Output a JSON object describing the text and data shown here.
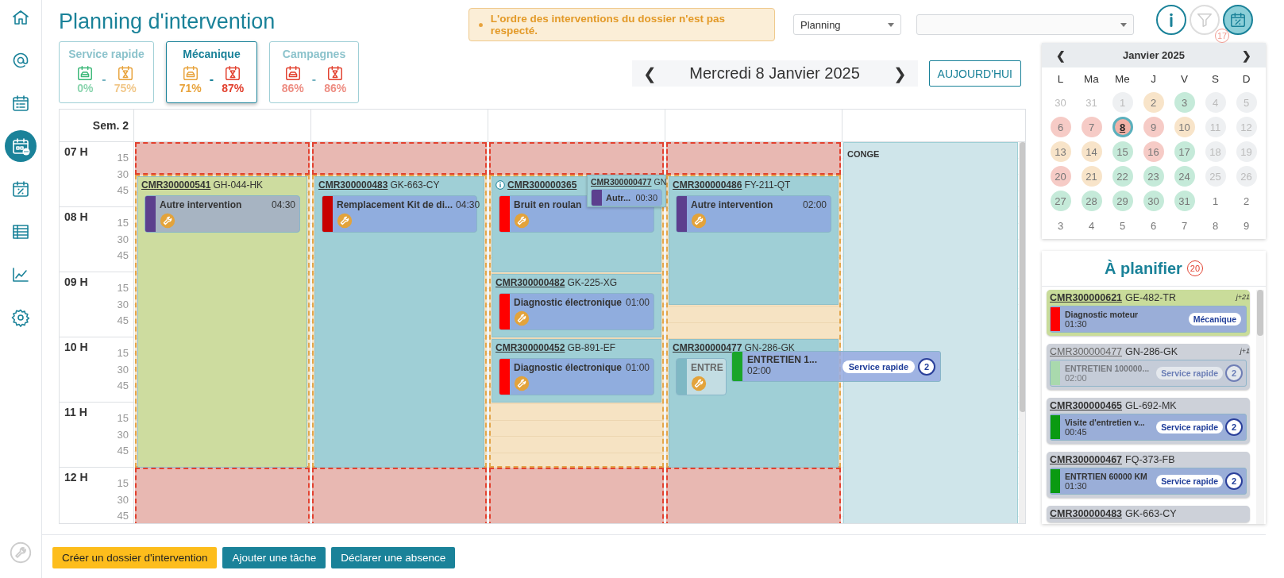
{
  "sidebar": {
    "items": [
      {
        "selected": false
      },
      {
        "selected": false
      },
      {
        "selected": false
      },
      {
        "selected": true
      },
      {
        "selected": false
      },
      {
        "selected": false
      },
      {
        "selected": false
      },
      {
        "selected": false
      }
    ]
  },
  "header": {
    "title": "Planning d'intervention"
  },
  "alert": {
    "messages": [
      "L'ordre des interventions du dossier n'est pas respecté."
    ]
  },
  "view_select": {
    "value": "Planning"
  },
  "toolbar": {
    "filter_count": "17",
    "filter_disabled": true,
    "planning_selected": true
  },
  "counters": [
    {
      "label": "Service rapide",
      "selected": false,
      "separator": "-",
      "stats": [
        {
          "value": "0%",
          "color": "#3cb878"
        },
        {
          "value": "75%",
          "color": "#e8a33c"
        }
      ]
    },
    {
      "label": "Mécanique",
      "selected": true,
      "separator": "-",
      "stats": [
        {
          "value": "71%",
          "color": "#e8a33c"
        },
        {
          "value": "87%",
          "color": "#e2412f"
        }
      ]
    },
    {
      "label": "Campagnes",
      "selected": false,
      "separator": "-",
      "stats": [
        {
          "value": "86%",
          "color": "#e2412f"
        },
        {
          "value": "86%",
          "color": "#e2412f"
        }
      ]
    }
  ],
  "date_nav": {
    "prev": "❮",
    "date": "Mercredi 8 Janvier 2025",
    "next": "❯",
    "today": "AUJOURD'HUI"
  },
  "planning": {
    "week": "Sem. 2",
    "hours": [
      {
        "label": "07 H",
        "quarters": [
          "15",
          "30",
          "45"
        ]
      },
      {
        "label": "08 H",
        "quarters": [
          "15",
          "30",
          "45"
        ]
      },
      {
        "label": "09 H",
        "quarters": [
          "15",
          "30",
          "45"
        ]
      },
      {
        "label": "10 H",
        "quarters": [
          "15",
          "30",
          "45"
        ]
      },
      {
        "label": "11 H",
        "quarters": [
          "15",
          "30",
          "45"
        ]
      },
      {
        "label": "12 H",
        "quarters": [
          "15",
          "30",
          "45"
        ]
      }
    ],
    "resources": [
      {
        "blocks": [
          {
            "kind": "closed"
          },
          {
            "kind": "open"
          },
          {
            "kind": "closed"
          },
          {
            "kind": "dossier",
            "color": "#cddc9f",
            "info": false,
            "id": "CMR300000541",
            "plate": "GH-044-HK",
            "tasks": [
              {
                "name": "Autre intervention",
                "duration": "04:30",
                "color": "#5c3f8e",
                "ghost": false
              }
            ]
          }
        ]
      },
      {
        "blocks": [
          {
            "kind": "closed"
          },
          {
            "kind": "open"
          },
          {
            "kind": "closed"
          },
          {
            "kind": "dossier",
            "color": "#9fcfd6",
            "info": false,
            "id": "CMR300000483",
            "plate": "GK-663-CY",
            "tasks": [
              {
                "name": "Remplacement Kit de di...",
                "duration": "04:30",
                "color": "#c80000",
                "ghost": false
              }
            ]
          }
        ]
      },
      {
        "blocks": [
          {
            "kind": "closed"
          },
          {
            "kind": "open"
          },
          {
            "kind": "closed"
          },
          {
            "kind": "dossier",
            "color": "#9fcfd6",
            "info": true,
            "id": "CMR300000365",
            "tasks": [
              {
                "name": "Bruit en roulan",
                "color": "#ff0000",
                "ghost": false
              }
            ]
          },
          {
            "kind": "overlay",
            "color": "#9fcfd6",
            "info": false,
            "id": "CMR300000477",
            "plate": "GN",
            "tasks": [
              {
                "name": "Autr...",
                "duration": "00:30",
                "color": "#5c3f8e",
                "ghost": false
              }
            ]
          },
          {
            "kind": "dossier",
            "color": "#9fcfd6",
            "info": false,
            "id": "CMR300000482",
            "plate": "GK-225-XG",
            "tasks": [
              {
                "name": "Diagnostic électronique",
                "duration": "01:00",
                "color": "#ff0000",
                "ghost": false
              }
            ]
          },
          {
            "kind": "dossier",
            "color": "#9fcfd6",
            "info": false,
            "id": "CMR300000452",
            "plate": "GB-891-EF",
            "tasks": [
              {
                "name": "Diagnostic électronique",
                "duration": "01:00",
                "color": "#ff0000",
                "ghost": false
              }
            ]
          }
        ]
      },
      {
        "blocks": [
          {
            "kind": "closed"
          },
          {
            "kind": "open"
          },
          {
            "kind": "closed"
          },
          {
            "kind": "dossier",
            "color": "#9fcfd6",
            "info": false,
            "id": "CMR300000486",
            "plate": "FY-211-QT",
            "tasks": [
              {
                "name": "Autre intervention",
                "duration": "02:00",
                "color": "#5c3f8e",
                "ghost": false
              }
            ]
          },
          {
            "kind": "dossier",
            "color": "#9fcfd6",
            "info": false,
            "id": "CMR300000477",
            "plate": "GN-286-GK",
            "tasks": [
              {
                "name": "ENTRE",
                "color": "#7fb8c4",
                "ghost": true
              }
            ]
          }
        ]
      },
      {
        "blocks": [
          {
            "kind": "absence",
            "label": "CONGE"
          }
        ]
      }
    ],
    "drag_preview": {
      "name": "ENTRETIEN 1...",
      "duration": "02:00",
      "color": "#1aa52a",
      "category": "Service rapide",
      "count": "2"
    }
  },
  "calendar": {
    "prev": "❮",
    "title": "Janvier 2025",
    "next": "❯",
    "weekdays": [
      "L",
      "Ma",
      "Me",
      "J",
      "V",
      "S",
      "D"
    ],
    "days": [
      {
        "label": "30",
        "dim": true,
        "selected": false
      },
      {
        "label": "31",
        "dim": true,
        "selected": false
      },
      {
        "label": "1",
        "color": "#eef0f2",
        "dim": true,
        "selected": false
      },
      {
        "label": "2",
        "color": "#f8e4c9",
        "selected": false
      },
      {
        "label": "3",
        "color": "#c5ead9",
        "selected": false
      },
      {
        "label": "4",
        "color": "#eef0f2",
        "dim": true,
        "selected": false
      },
      {
        "label": "5",
        "color": "#eef0f2",
        "dim": true,
        "selected": false
      },
      {
        "label": "6",
        "color": "#f6cbc6",
        "selected": false
      },
      {
        "label": "7",
        "color": "#f6cbc6",
        "selected": false
      },
      {
        "label": "8",
        "color": "#f2b1a6",
        "selected": true
      },
      {
        "label": "9",
        "color": "#f6cbc6",
        "selected": false
      },
      {
        "label": "10",
        "color": "#f8e4c9",
        "selected": false
      },
      {
        "label": "11",
        "color": "#eef0f2",
        "dim": true,
        "selected": false
      },
      {
        "label": "12",
        "color": "#eef0f2",
        "dim": true,
        "selected": false
      },
      {
        "label": "13",
        "color": "#f8e4c9",
        "selected": false
      },
      {
        "label": "14",
        "color": "#f8e4c9",
        "selected": false
      },
      {
        "label": "15",
        "color": "#c5ead9",
        "selected": false
      },
      {
        "label": "16",
        "color": "#f6cbc6",
        "selected": false
      },
      {
        "label": "17",
        "color": "#c5ead9",
        "selected": false
      },
      {
        "label": "18",
        "color": "#eef0f2",
        "dim": true,
        "selected": false
      },
      {
        "label": "19",
        "color": "#eef0f2",
        "dim": true,
        "selected": false
      },
      {
        "label": "20",
        "color": "#f6cbc6",
        "selected": false
      },
      {
        "label": "21",
        "color": "#f8e4c9",
        "selected": false
      },
      {
        "label": "22",
        "color": "#c5ead9",
        "selected": false
      },
      {
        "label": "23",
        "color": "#c5ead9",
        "selected": false
      },
      {
        "label": "24",
        "color": "#c5ead9",
        "selected": false
      },
      {
        "label": "25",
        "color": "#eef0f2",
        "dim": true,
        "selected": false
      },
      {
        "label": "26",
        "color": "#eef0f2",
        "dim": true,
        "selected": false
      },
      {
        "label": "27",
        "color": "#c5ead9",
        "selected": false
      },
      {
        "label": "28",
        "color": "#c5ead9",
        "selected": false
      },
      {
        "label": "29",
        "color": "#c5ead9",
        "selected": false
      },
      {
        "label": "30",
        "color": "#c5ead9",
        "selected": false
      },
      {
        "label": "31",
        "color": "#c5ead9",
        "selected": false
      },
      {
        "label": "1",
        "selected": false
      },
      {
        "label": "2",
        "selected": false
      },
      {
        "label": "3",
        "selected": false
      },
      {
        "label": "4",
        "selected": false
      },
      {
        "label": "5",
        "selected": false
      },
      {
        "label": "6",
        "selected": false
      },
      {
        "label": "7",
        "selected": false
      },
      {
        "label": "8",
        "selected": false
      },
      {
        "label": "9",
        "selected": false
      }
    ]
  },
  "backlog": {
    "title": "À planifier",
    "count": "20",
    "items": [
      {
        "id": "CMR300000621",
        "plate": "GE-482-TR",
        "delay": "j+21",
        "color": "#c9dc9a",
        "disabled": false,
        "task": {
          "name": "Diagnostic moteur",
          "duration": "01:30",
          "color": "#ff0000",
          "category": "Mécanique"
        }
      },
      {
        "id": "CMR300000477",
        "plate": "GN-286-GK",
        "delay": "j+1",
        "color": "#cdd1d9",
        "disabled": true,
        "task": {
          "name": "ENTRETIEN 100000...",
          "duration": "02:00",
          "color": "#a9d9ad",
          "category": "Service rapide",
          "count": "2"
        }
      },
      {
        "id": "CMR300000465",
        "plate": "GL-692-MK",
        "color": "#cdd1d9",
        "disabled": false,
        "task": {
          "name": "Visite d'entretien v...",
          "duration": "00:45",
          "color": "#0a9a12",
          "category": "Service rapide",
          "count": "2"
        }
      },
      {
        "id": "CMR300000467",
        "plate": "FQ-373-FB",
        "color": "#cdd1d9",
        "disabled": false,
        "task": {
          "name": "ENTRTIEN 60000 KM",
          "duration": "01:30",
          "color": "#0a9a12",
          "category": "Service rapide",
          "count": "2"
        }
      },
      {
        "id": "CMR300000483",
        "plate": "GK-663-CY",
        "color": "#cdd1d9",
        "disabled": false
      }
    ]
  },
  "footer": {
    "buttons": [
      {
        "label": "Créer un dossier d'intervention",
        "kind": "primary"
      },
      {
        "label": "Ajouter une tâche",
        "kind": "secondary"
      },
      {
        "label": "Déclarer une absence",
        "kind": "secondary"
      }
    ]
  }
}
